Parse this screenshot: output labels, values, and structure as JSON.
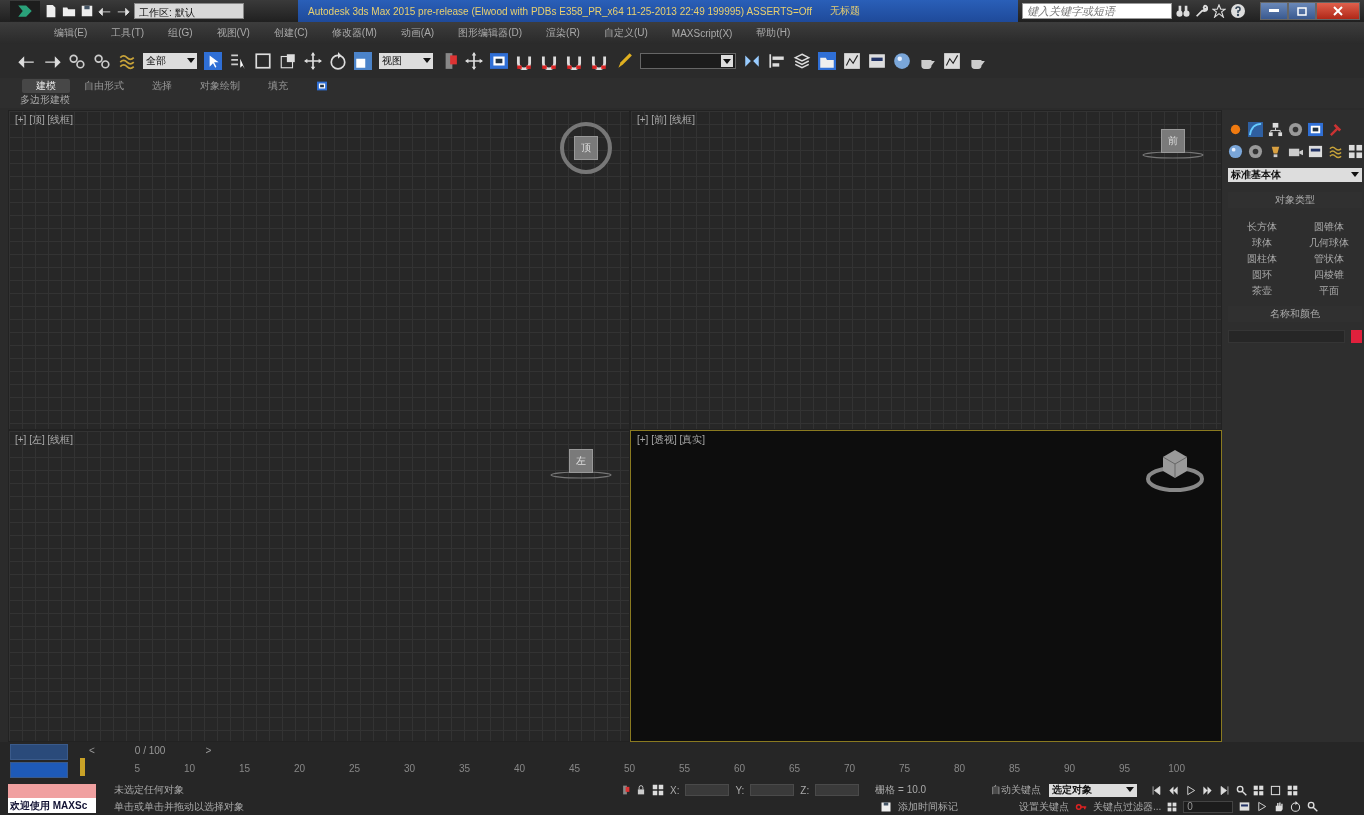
{
  "title_bar": {
    "workspace": "工作区: 默认",
    "title": "Autodesk 3ds Max 2015 pre-release (Elwood with PDBs E358_PR_x64 11-25-2013 22:49 199995) ASSERTS=Off",
    "document": "无标题",
    "search_placeholder": "键入关键字或短语"
  },
  "menu": [
    "编辑(E)",
    "工具(T)",
    "组(G)",
    "视图(V)",
    "创建(C)",
    "修改器(M)",
    "动画(A)",
    "图形编辑器(D)",
    "渲染(R)",
    "自定义(U)",
    "MAXScript(X)",
    "帮助(H)"
  ],
  "toolbar": {
    "selection_filter": "全部",
    "reference_coordinate": "视图"
  },
  "ribbon": {
    "tabs": [
      {
        "label": "建模",
        "selected": true
      },
      {
        "label": "自由形式",
        "selected": false
      },
      {
        "label": "选择",
        "selected": false
      },
      {
        "label": "对象绘制",
        "selected": false
      },
      {
        "label": "填充",
        "selected": false
      }
    ],
    "panel": "多边形建模"
  },
  "viewports": [
    {
      "label": "[+] [顶] [线框]",
      "cube_label": "顶",
      "kind": "ortho_ring",
      "active": false
    },
    {
      "label": "[+] [前] [线框]",
      "cube_label": "前",
      "kind": "ortho_flat",
      "active": false
    },
    {
      "label": "[+] [左] [线框]",
      "cube_label": "左",
      "kind": "ortho_flat",
      "active": false
    },
    {
      "label": "[+] [透视] [真实]",
      "kind": "perspective",
      "active": true
    }
  ],
  "command_panel": {
    "category": "标准基本体",
    "rollout": "对象类型",
    "buttons": [
      "长方体",
      "圆锥体",
      "球体",
      "几何球体",
      "圆柱体",
      "管状体",
      "圆环",
      "四棱锥",
      "茶壶",
      "平面"
    ],
    "name_rollout": "名称和颜色"
  },
  "timeline": {
    "prev": "<",
    "position": "0 / 100",
    "next": ">",
    "ticks": [
      "5",
      "10",
      "15",
      "20",
      "25",
      "30",
      "35",
      "40",
      "45",
      "50",
      "55",
      "60",
      "65",
      "70",
      "75",
      "80",
      "85",
      "90",
      "95",
      "100"
    ]
  },
  "status": {
    "listener": "欢迎使用 MAXSc",
    "selection": "未选定任何对象",
    "prompt": "单击或单击并拖动以选择对象",
    "x_label": "X:",
    "y_label": "Y:",
    "z_label": "Z:",
    "grid": "栅格 = 10.0",
    "time_tag": "添加时间标记",
    "auto_key": "自动关键点",
    "key_mode": "选定对象",
    "set_key": "设置关键点",
    "key_filters": "关键点过滤器...",
    "frame": "0"
  }
}
